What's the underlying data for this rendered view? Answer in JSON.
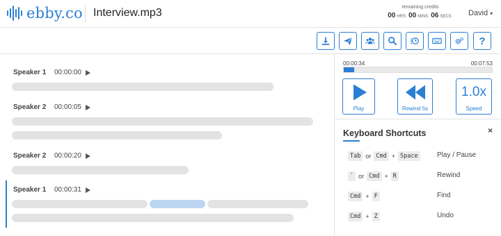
{
  "header": {
    "logo_text": "ebby.co",
    "file_name": "Interview.mp3",
    "credits_label": "remaining credits",
    "credits": {
      "hrs": "00",
      "hrs_unit": "HRS",
      "mins": "00",
      "mins_unit": "MINS",
      "secs": "06",
      "secs_unit": "SECS"
    },
    "user_name": "David",
    "caret": "▾"
  },
  "toolbar": {
    "buttons": [
      "download-icon",
      "send-icon",
      "speakers-icon",
      "search-icon",
      "timestamp-icon",
      "keyboard-icon",
      "settings-icon",
      "help-icon"
    ],
    "help_label": "?"
  },
  "transcript": {
    "segments": [
      {
        "speaker": "Speaker 1",
        "time": "00:00:00"
      },
      {
        "speaker": "Speaker 2",
        "time": "00:00:05"
      },
      {
        "speaker": "Speaker 2",
        "time": "00:00:20"
      },
      {
        "speaker": "Speaker 1",
        "time": "00:00:31",
        "active": true
      }
    ]
  },
  "player": {
    "current_time": "00:00:34",
    "total_time": "00:07:53",
    "progress_fraction": 0.072,
    "play_label": "Play",
    "rewind_label": "Rewind 5s",
    "speed_value": "1.0x",
    "speed_label": "Speed"
  },
  "shortcuts": {
    "title": "Keyboard Shortcuts",
    "close": "×",
    "or": "or",
    "plus": "+",
    "rows": [
      {
        "keys_a": "Tab",
        "keys_b1": "Cmd",
        "keys_b2": "Space",
        "action": "Play / Pause"
      },
      {
        "keys_a": "`",
        "keys_b1": "Cmd",
        "keys_b2": "R",
        "action": "Rewind"
      },
      {
        "keys_1": "Cmd",
        "keys_2": "F",
        "action": "Find"
      },
      {
        "keys_1": "Cmd",
        "keys_2": "Z",
        "action": "Undo"
      }
    ]
  },
  "colors": {
    "accent": "#2a7fd4",
    "placeholder": "#e3e3e3",
    "highlight": "#bcd6f2"
  }
}
